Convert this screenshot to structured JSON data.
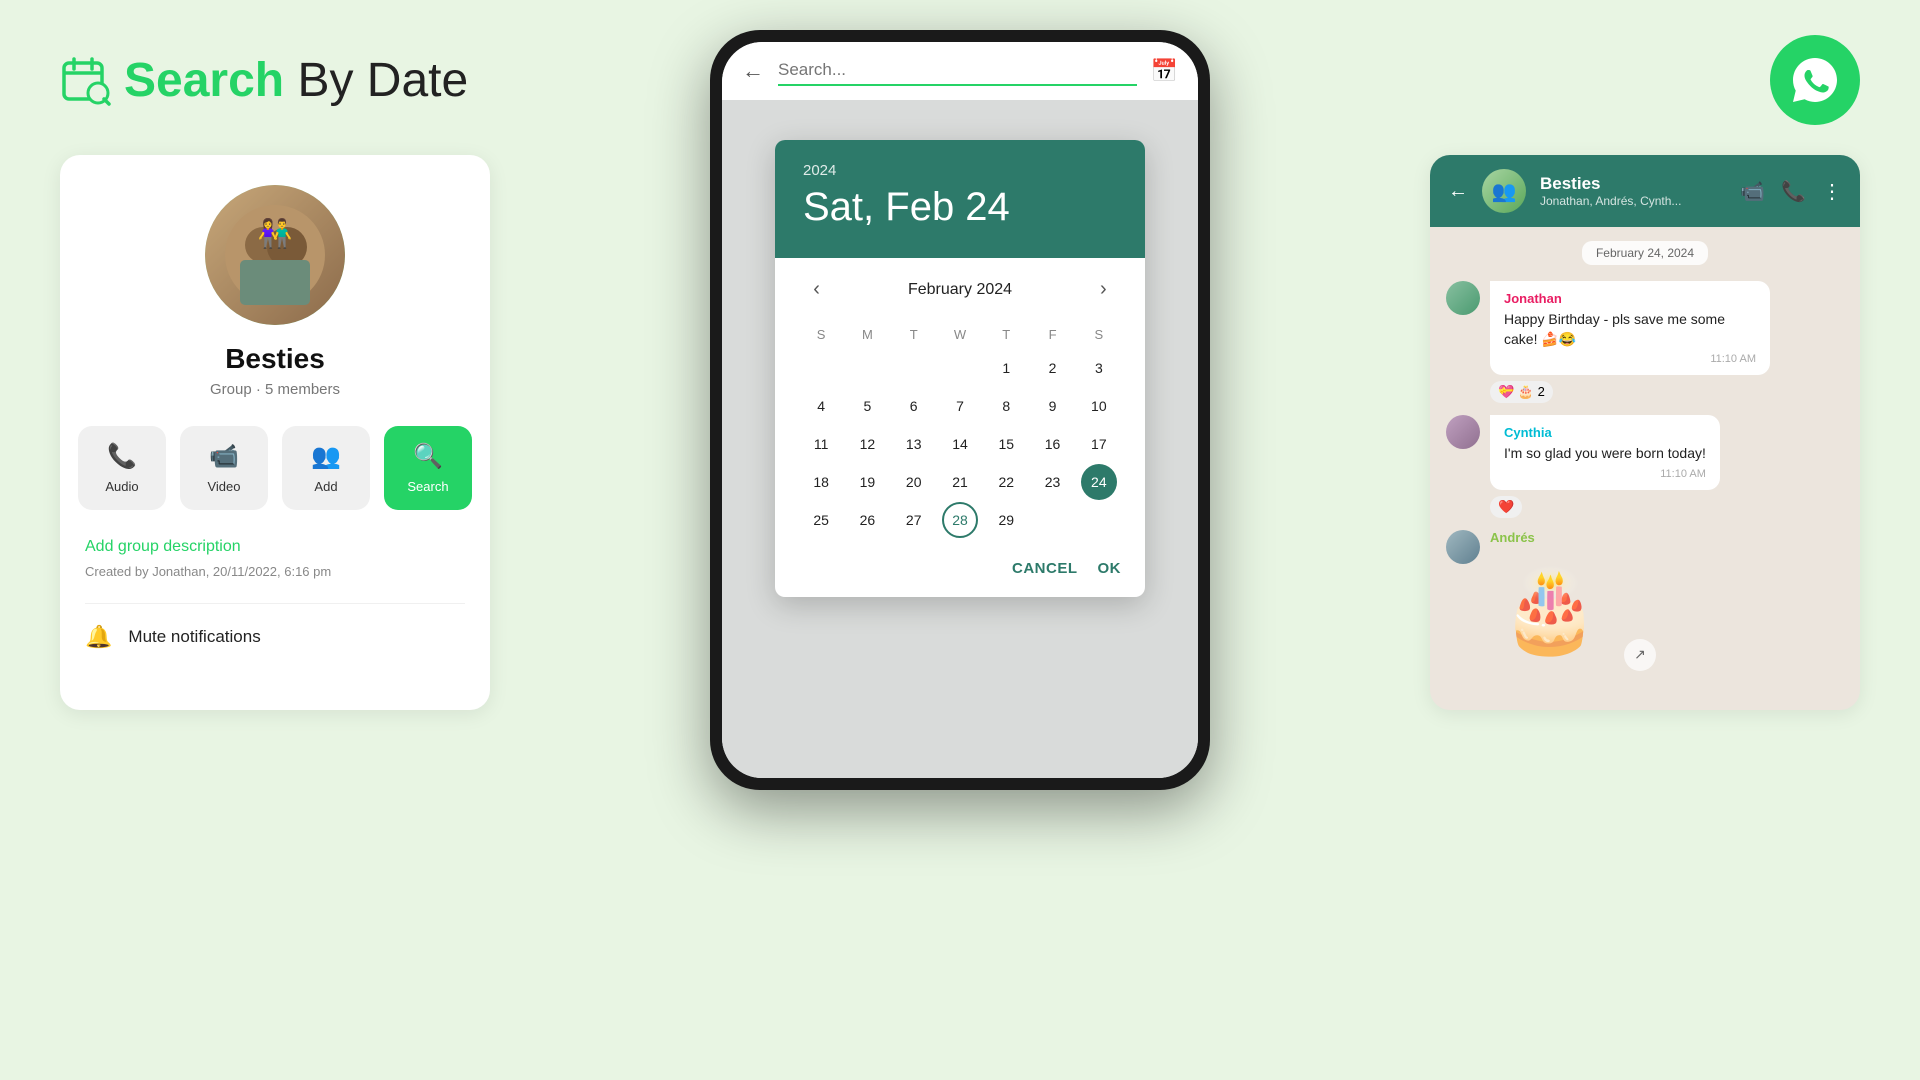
{
  "header": {
    "title_green": "Search",
    "title_rest": " By Date",
    "icon_label": "calendar-search-icon"
  },
  "whatsapp": {
    "logo_label": "whatsapp-logo"
  },
  "left_card": {
    "group_name": "Besties",
    "group_meta": "Group · 5 members",
    "buttons": [
      {
        "label": "Audio",
        "icon": "📞",
        "active": false
      },
      {
        "label": "Video",
        "icon": "📹",
        "active": false
      },
      {
        "label": "Add",
        "icon": "👥",
        "active": false
      },
      {
        "label": "Search",
        "icon": "🔍",
        "active": true
      }
    ],
    "add_description": "Add group description",
    "created_by": "Created by Jonathan, 20/11/2022, 6:16 pm",
    "mute_label": "Mute notifications"
  },
  "phone": {
    "search_placeholder": "Search...",
    "search_by_date_icon": "📅"
  },
  "calendar": {
    "year": "2024",
    "selected_date": "Sat, Feb 24",
    "month_label": "February 2024",
    "day_headers": [
      "S",
      "M",
      "T",
      "W",
      "T",
      "F",
      "S"
    ],
    "weeks": [
      [
        null,
        null,
        null,
        null,
        1,
        2,
        3
      ],
      [
        4,
        5,
        6,
        7,
        8,
        9,
        10
      ],
      [
        11,
        12,
        13,
        14,
        15,
        16,
        17
      ],
      [
        18,
        19,
        20,
        21,
        22,
        23,
        24
      ],
      [
        25,
        26,
        27,
        28,
        29,
        null,
        null
      ]
    ],
    "selected_day": 24,
    "circled_day": 28,
    "cancel_label": "Cancel",
    "ok_label": "OK"
  },
  "chat": {
    "header": {
      "name": "Besties",
      "members": "Jonathan, Andrés, Cynth..."
    },
    "date_badge": "February 24, 2024",
    "messages": [
      {
        "sender": "Jonathan",
        "sender_class": "jonathan",
        "text": "Happy Birthday - pls save me some cake! 🍰😂",
        "time": "11:10 AM",
        "reactions": [
          "💝",
          "🎂",
          "2"
        ]
      },
      {
        "sender": "Cynthia",
        "sender_class": "cynthia",
        "text": "I'm so glad you were born today!",
        "time": "11:10 AM",
        "reactions": [
          "❤️"
        ]
      },
      {
        "sender": "Andrés",
        "sender_class": "andres",
        "text": "",
        "time": "",
        "is_sticker": true
      }
    ]
  }
}
